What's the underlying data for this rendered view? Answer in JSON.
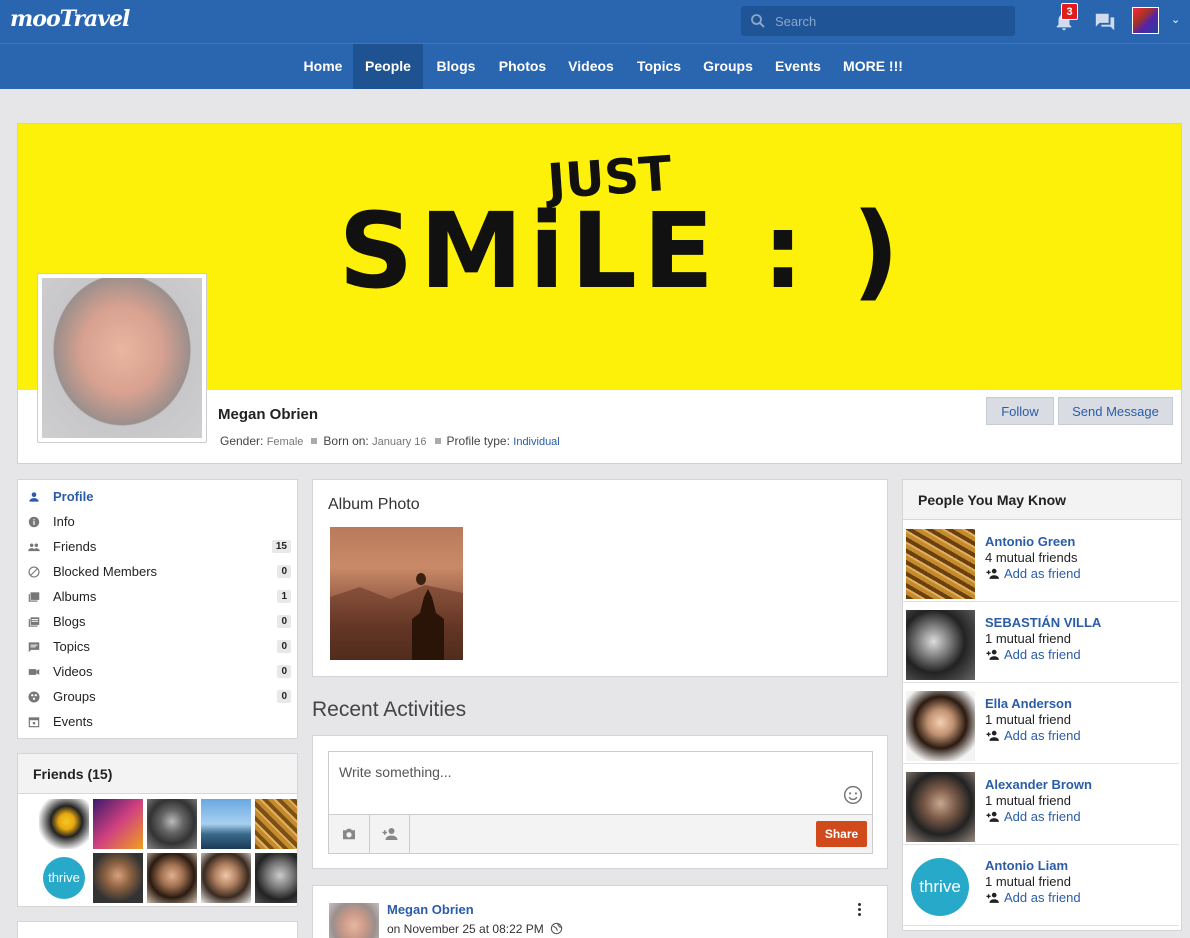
{
  "app": {
    "logo": "mooTravel"
  },
  "topbar": {
    "search_placeholder": "Search",
    "notification_count": "3"
  },
  "nav": {
    "items": [
      "Home",
      "People",
      "Blogs",
      "Photos",
      "Videos",
      "Topics",
      "Groups",
      "Events",
      "MORE !!!"
    ],
    "active": "People"
  },
  "cover": {
    "line1": "JUST",
    "line2": "SMiLE : )"
  },
  "profile": {
    "name": "Megan Obrien",
    "gender_label": "Gender:",
    "gender": "Female",
    "born_label": "Born on:",
    "born": "January 16",
    "type_label": "Profile type:",
    "type": "Individual",
    "follow": "Follow",
    "message": "Send Message"
  },
  "sidebar": {
    "items": [
      {
        "label": "Profile",
        "count": ""
      },
      {
        "label": "Info",
        "count": ""
      },
      {
        "label": "Friends",
        "count": "15"
      },
      {
        "label": "Blocked Members",
        "count": "0"
      },
      {
        "label": "Albums",
        "count": "1"
      },
      {
        "label": "Blogs",
        "count": "0"
      },
      {
        "label": "Topics",
        "count": "0"
      },
      {
        "label": "Videos",
        "count": "0"
      },
      {
        "label": "Groups",
        "count": "0"
      },
      {
        "label": "Events",
        "count": ""
      }
    ],
    "icons": [
      "person-icon",
      "info-icon",
      "people-icon",
      "block-icon",
      "albums-icon",
      "blog-icon",
      "topic-icon",
      "video-icon",
      "groups-icon",
      "calendar-icon"
    ]
  },
  "friends": {
    "title": "Friends (15)",
    "thrive": "thrive"
  },
  "album": {
    "title": "Album Photo"
  },
  "activities": {
    "title": "Recent Activities",
    "placeholder": "Write something...",
    "share": "Share"
  },
  "post": {
    "author": "Megan Obrien",
    "time": "on November 25 at 08:22 PM"
  },
  "pymk": {
    "title": "People You May Know",
    "add_label": "Add as friend",
    "people": [
      {
        "name": "Antonio Green",
        "mutual": "4 mutual friends"
      },
      {
        "name": "SEBASTIÁN VILLA",
        "mutual": "1 mutual friend"
      },
      {
        "name": "Ella Anderson",
        "mutual": "1 mutual friend"
      },
      {
        "name": "Alexander Brown",
        "mutual": "1 mutual friend"
      },
      {
        "name": "Antonio Liam",
        "mutual": "1 mutual friend"
      }
    ],
    "thrive": "thrive"
  },
  "colors": {
    "brand": "#2a66b0",
    "link": "#2a5ca8",
    "share": "#d04a1c",
    "badge": "#e21c1c",
    "cover": "#fdf10a"
  }
}
